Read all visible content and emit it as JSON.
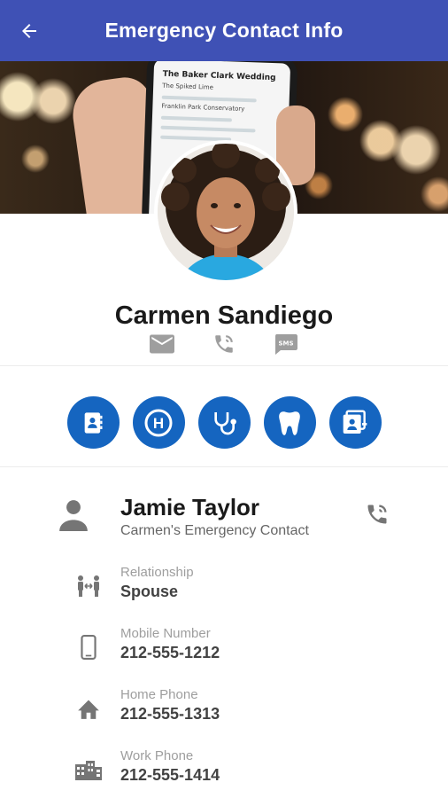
{
  "appbar": {
    "title": "Emergency Contact Info",
    "back_icon": "arrow-left-icon"
  },
  "profile": {
    "name": "Carmen Sandiego",
    "actions": [
      {
        "name": "email",
        "icon": "email-icon"
      },
      {
        "name": "call",
        "icon": "phone-call-icon"
      },
      {
        "name": "sms",
        "icon": "sms-icon",
        "label": "SMS"
      }
    ]
  },
  "quick_actions": [
    {
      "name": "contacts",
      "icon": "contact-book-icon"
    },
    {
      "name": "hospital",
      "icon": "hospital-icon",
      "label": "H"
    },
    {
      "name": "doctor",
      "icon": "stethoscope-icon"
    },
    {
      "name": "dentist",
      "icon": "tooth-icon"
    },
    {
      "name": "insurance",
      "icon": "id-card-icon"
    }
  ],
  "emergency_contact": {
    "name": "Jamie Taylor",
    "subtitle": "Carmen's Emergency Contact",
    "fields": [
      {
        "label": "Relationship",
        "value": "Spouse",
        "icon": "relationship-icon"
      },
      {
        "label": "Mobile Number",
        "value": "212-555-1212",
        "icon": "mobile-phone-icon"
      },
      {
        "label": "Home Phone",
        "value": "212-555-1313",
        "icon": "home-icon"
      },
      {
        "label": "Work Phone",
        "value": "212-555-1414",
        "icon": "building-icon"
      }
    ]
  },
  "hero_phone": {
    "title": "The Baker Clark Wedding",
    "subtitle": "The Spiked Lime",
    "line3": "Franklin Park Conservatory"
  },
  "colors": {
    "appbar": "#3f51b5",
    "quick_action": "#1565c0",
    "icon_grey": "#757575"
  }
}
